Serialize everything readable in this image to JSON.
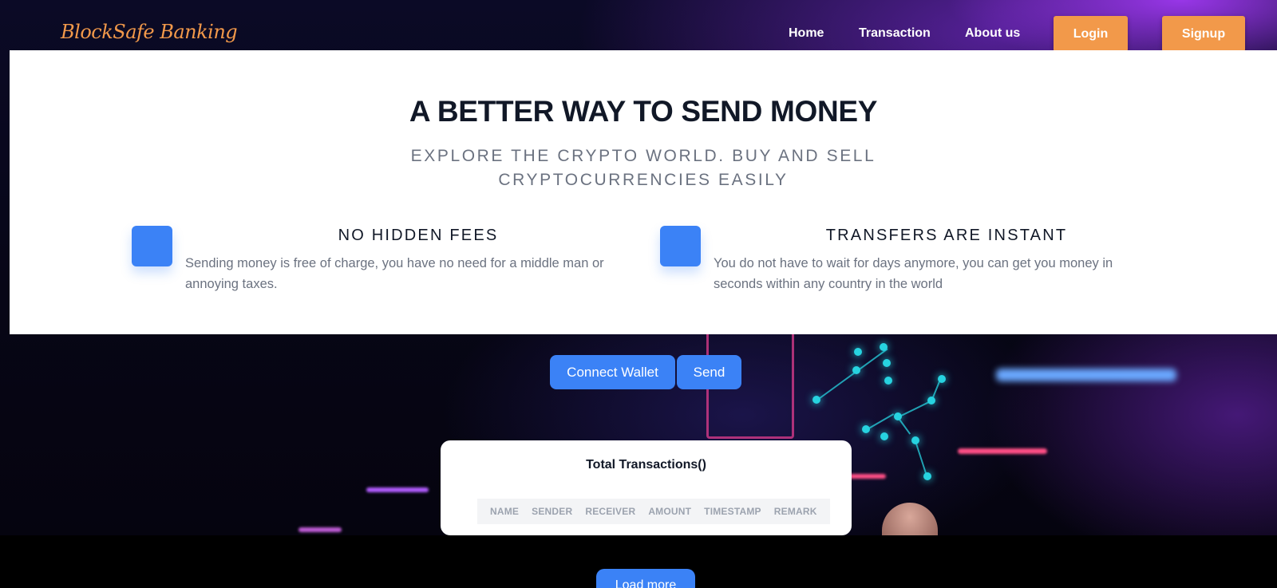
{
  "header": {
    "brand": "BlockSafe Banking",
    "nav": {
      "home": "Home",
      "transaction": "Transaction",
      "about": "About us"
    },
    "login_label": "Login",
    "signup_label": "Signup"
  },
  "hero": {
    "headline": "A BETTER WAY TO SEND MONEY",
    "subheadline": "EXPLORE THE CRYPTO WORLD. BUY AND SELL CRYPTOCURRENCIES EASILY",
    "features": [
      {
        "title": "NO HIDDEN FEES",
        "description": "Sending money is free of charge, you have no need for a middle man or annoying taxes."
      },
      {
        "title": "TRANSFERS ARE INSTANT",
        "description": "You do not have to wait for days anymore, you can get you money in seconds within any country in the world"
      }
    ]
  },
  "actions": {
    "connect_wallet_label": "Connect Wallet",
    "send_label": "Send"
  },
  "transactions": {
    "title": "Total Transactions()",
    "columns": [
      "NAME",
      "SENDER",
      "RECEIVER",
      "AMOUNT",
      "TIMESTAMP",
      "REMARK"
    ]
  },
  "load_more_label": "Load more",
  "colors": {
    "accent_orange": "#f2994a",
    "accent_blue": "#3b82f6",
    "text_dark": "#111827",
    "text_muted": "#6b7280"
  }
}
